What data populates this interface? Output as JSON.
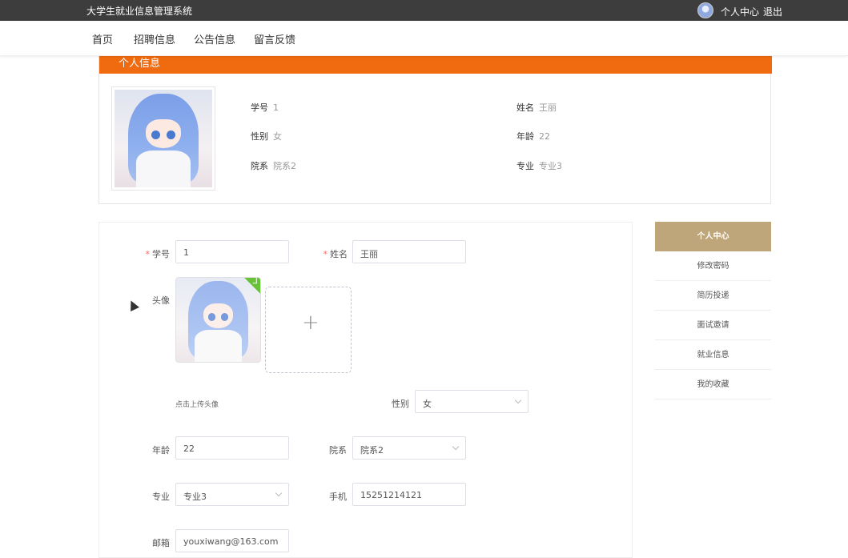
{
  "topbar": {
    "title": "大学生就业信息管理系统",
    "personal_center": "个人中心",
    "logout": "退出"
  },
  "nav": {
    "items": [
      {
        "label": "首页"
      },
      {
        "label": "招聘信息"
      },
      {
        "label": "公告信息"
      },
      {
        "label": "留言反馈"
      }
    ]
  },
  "info": {
    "header": "个人信息",
    "student_id": {
      "label": "学号",
      "value": "1"
    },
    "name": {
      "label": "姓名",
      "value": "王丽"
    },
    "gender": {
      "label": "性别",
      "value": "女"
    },
    "age": {
      "label": "年龄",
      "value": "22"
    },
    "department": {
      "label": "院系",
      "value": "院系2"
    },
    "major": {
      "label": "专业",
      "value": "专业3"
    }
  },
  "form": {
    "student_id": {
      "label": "学号",
      "value": "1"
    },
    "name": {
      "label": "姓名",
      "value": "王丽"
    },
    "avatar": {
      "label": "头像",
      "hint": "点击上传头像"
    },
    "gender": {
      "label": "性别",
      "value": "女"
    },
    "age": {
      "label": "年龄",
      "value": "22"
    },
    "department": {
      "label": "院系",
      "value": "院系2"
    },
    "major": {
      "label": "专业",
      "value": "专业3"
    },
    "phone": {
      "label": "手机",
      "value": "15251214121"
    },
    "email": {
      "label": "邮箱",
      "value": "youxiwang@163.com"
    },
    "required_mark": "*"
  },
  "sidebar": {
    "items": [
      {
        "label": "个人中心"
      },
      {
        "label": "修改密码"
      },
      {
        "label": "简历投递"
      },
      {
        "label": "面试邀请"
      },
      {
        "label": "就业信息"
      },
      {
        "label": "我的收藏"
      }
    ]
  },
  "colors": {
    "header_orange": "#f06a0f",
    "sidebar_active": "#bfa67a",
    "topbar": "#3d3d3d"
  },
  "icons": {
    "avatar": "user-avatar",
    "upload_check": "check-icon",
    "upload_add": "plus-icon",
    "select_arrow": "chevron-down-icon"
  }
}
